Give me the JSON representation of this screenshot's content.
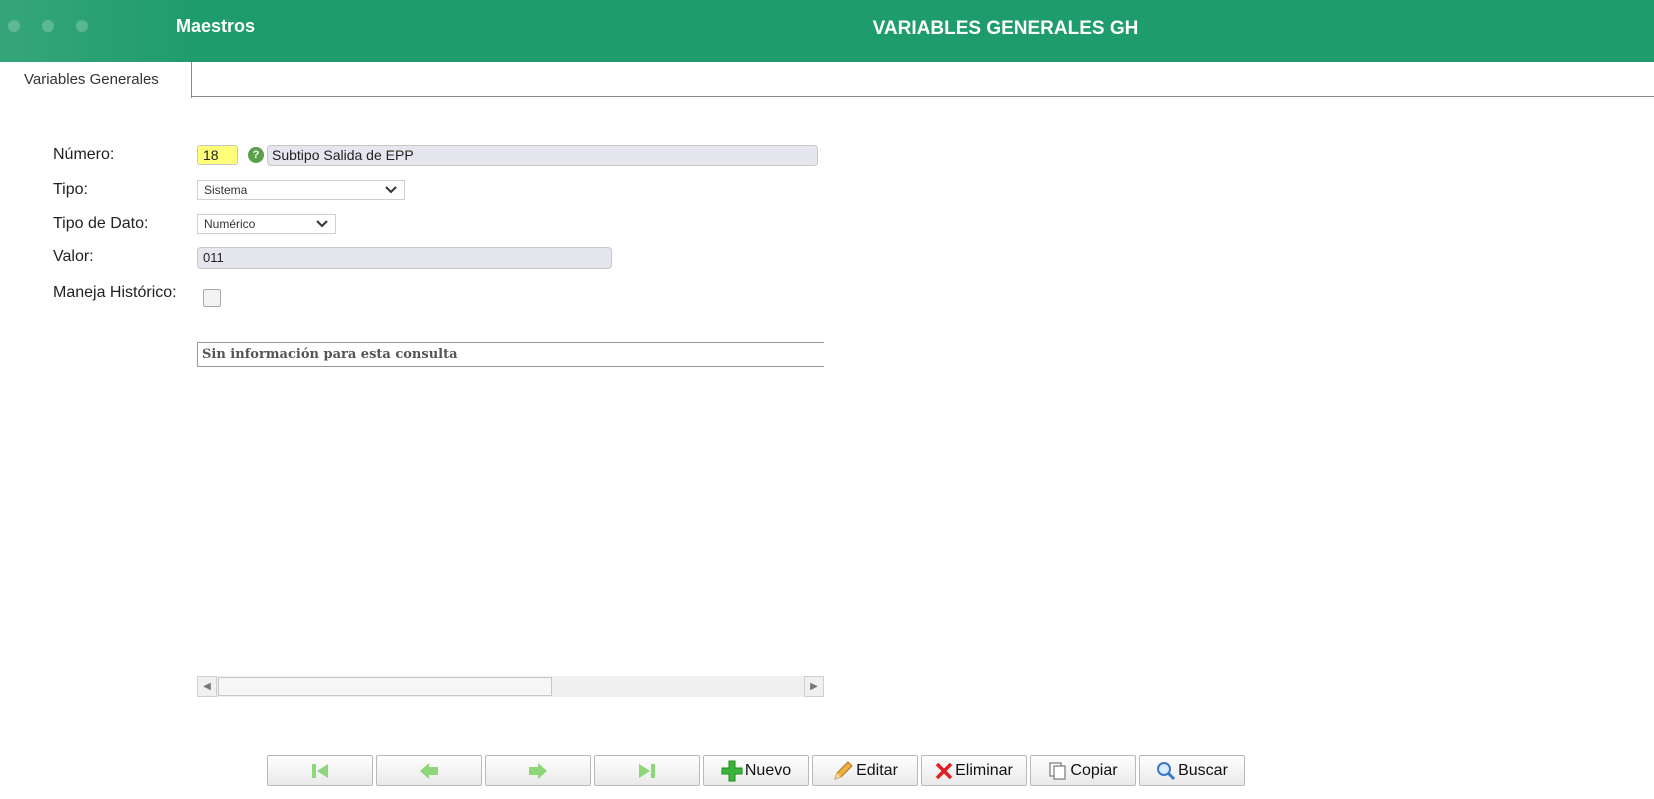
{
  "header": {
    "module": "Maestros",
    "title": "VARIABLES GENERALES GH",
    "background": "#1f9c6b"
  },
  "tabs": [
    {
      "label": "Variables Generales",
      "active": true
    }
  ],
  "form": {
    "numero": {
      "label": "Número:",
      "value": "18",
      "description": "Subtipo Salida de EPP"
    },
    "tipo": {
      "label": "Tipo:",
      "selected": "Sistema"
    },
    "tipo_dato": {
      "label": "Tipo de Dato:",
      "selected": "Numérico"
    },
    "valor": {
      "label": "Valor:",
      "value": "011"
    },
    "historico": {
      "label": "Maneja Histórico:",
      "checked": false
    }
  },
  "grid": {
    "empty_message": "Sin información para esta consulta"
  },
  "toolbar": {
    "first_icon": "first-record-icon",
    "prev_icon": "previous-record-icon",
    "next_icon": "next-record-icon",
    "last_icon": "last-record-icon",
    "nuevo": "Nuevo",
    "editar": "Editar",
    "eliminar": "Eliminar",
    "copiar": "Copiar",
    "buscar": "Buscar"
  }
}
